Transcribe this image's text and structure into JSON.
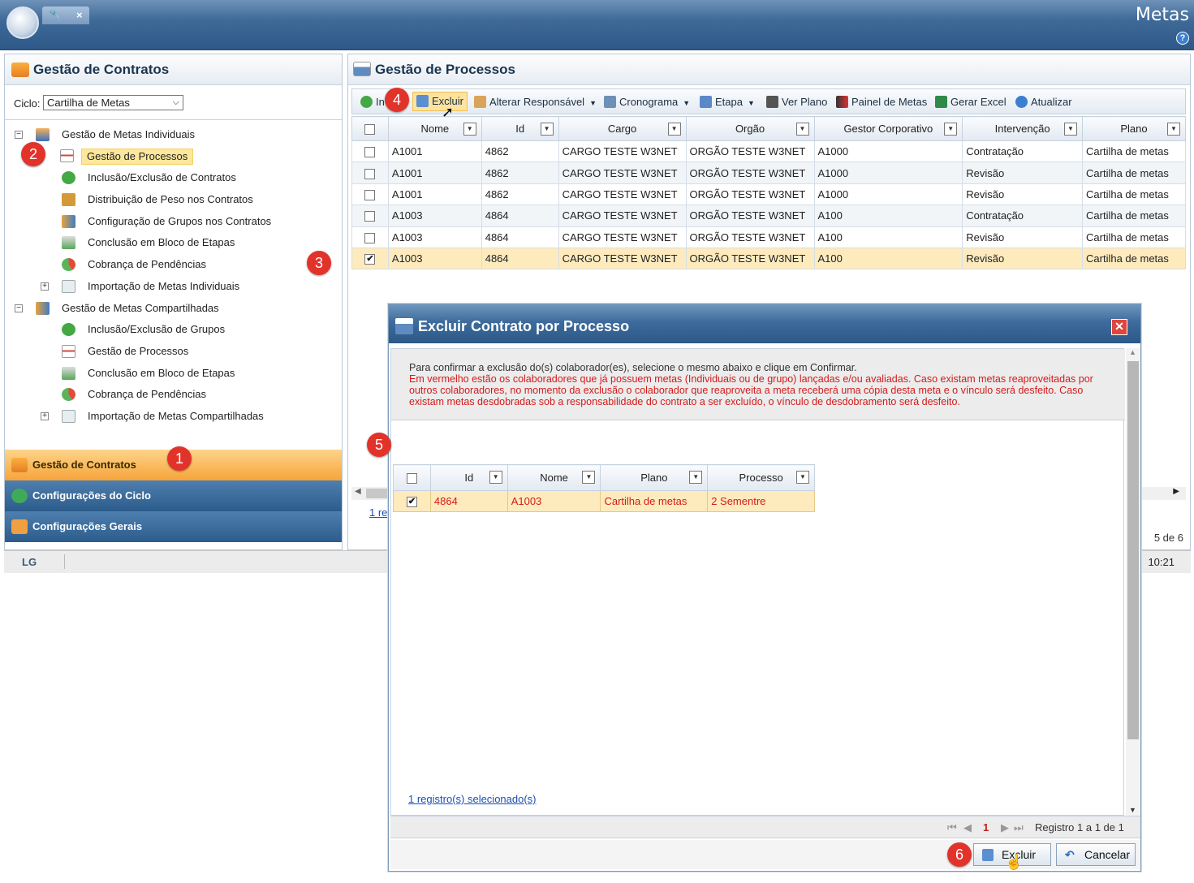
{
  "app": {
    "title": "Metas",
    "tab_icon": "wrench-icon",
    "tab_close": "×"
  },
  "left": {
    "title": "Gestão de Contratos",
    "ciclo_label": "Ciclo:",
    "ciclo_value": "Cartilha de Metas",
    "tree": [
      {
        "label": "Gestão de Metas Individuais",
        "expander": "⊟"
      },
      {
        "label": "Gestão de Processos"
      },
      {
        "label": "Inclusão/Exclusão de Contratos"
      },
      {
        "label": "Distribuição de Peso nos Contratos"
      },
      {
        "label": "Configuração de Grupos nos Contratos"
      },
      {
        "label": "Conclusão em Bloco de Etapas"
      },
      {
        "label": "Cobrança de Pendências"
      },
      {
        "label": "Importação de Metas Individuais",
        "expander": "⊞"
      },
      {
        "label": "Gestão de Metas Compartilhadas",
        "expander": "⊟"
      },
      {
        "label": "Inclusão/Exclusão de Grupos"
      },
      {
        "label": "Gestão de Processos"
      },
      {
        "label": "Conclusão em Bloco de Etapas"
      },
      {
        "label": "Cobrança de Pendências"
      },
      {
        "label": "Importação de Metas Compartilhadas",
        "expander": "⊞"
      }
    ],
    "accordion": [
      "Gestão de Contratos",
      "Configurações do Ciclo",
      "Configurações Gerais"
    ]
  },
  "right": {
    "title": "Gestão de Processos",
    "toolbar": {
      "incluir": "In",
      "excluir": "Excluir",
      "alterar": "Alterar Responsável",
      "cronograma": "Cronograma",
      "etapa": "Etapa",
      "ver_plano": "Ver Plano",
      "painel": "Painel de Metas",
      "gerar_excel": "Gerar Excel",
      "atualizar": "Atualizar"
    },
    "columns": [
      "Nome",
      "Id",
      "Cargo",
      "Orgão",
      "Gestor Corporativo",
      "Intervenção",
      "Plano"
    ],
    "rows": [
      {
        "checked": "",
        "nome": "A1001",
        "id": "4862",
        "cargo": "CARGO TESTE W3NET",
        "orgao": "ORGÃO TESTE W3NET",
        "gestor": "A1000",
        "intervencao": "Contratação",
        "plano": "Cartilha de metas"
      },
      {
        "checked": "",
        "nome": "A1001",
        "id": "4862",
        "cargo": "CARGO TESTE W3NET",
        "orgao": "ORGÃO TESTE W3NET",
        "gestor": "A1000",
        "intervencao": "Revisão",
        "plano": "Cartilha de metas"
      },
      {
        "checked": "",
        "nome": "A1001",
        "id": "4862",
        "cargo": "CARGO TESTE W3NET",
        "orgao": "ORGÃO TESTE W3NET",
        "gestor": "A1000",
        "intervencao": "Revisão",
        "plano": "Cartilha de metas"
      },
      {
        "checked": "",
        "nome": "A1003",
        "id": "4864",
        "cargo": "CARGO TESTE W3NET",
        "orgao": "ORGÃO TESTE W3NET",
        "gestor": "A100",
        "intervencao": "Contratação",
        "plano": "Cartilha de metas"
      },
      {
        "checked": "",
        "nome": "A1003",
        "id": "4864",
        "cargo": "CARGO TESTE W3NET",
        "orgao": "ORGÃO TESTE W3NET",
        "gestor": "A100",
        "intervencao": "Revisão",
        "plano": "Cartilha de metas"
      },
      {
        "checked": "✔",
        "nome": "A1003",
        "id": "4864",
        "cargo": "CARGO TESTE W3NET",
        "orgao": "ORGÃO TESTE W3NET",
        "gestor": "A100",
        "intervencao": "Revisão",
        "plano": "Cartilha de metas"
      }
    ],
    "pager_link": "1 re",
    "pager_right": "5 de 6"
  },
  "status": {
    "logo": "LG",
    "clock": "10:21"
  },
  "dialog": {
    "title": "Excluir Contrato por Processo",
    "close": "✕",
    "message1": "Para confirmar a exclusão do(s) colaborador(es), selecione o mesmo abaixo e clique em Confirmar.",
    "message2": "Em vermelho estão os colaboradores que já possuem metas (Individuais ou de grupo) lançadas e/ou avaliadas. Caso existam metas reaproveitadas por outros colaboradores, no momento da exclusão o colaborador que reaproveita a meta receberá uma cópia desta meta e o vínculo será desfeito. Caso existam metas desdobradas sob a responsabilidade do contrato a ser excluído, o vínculo de desdobramento será desfeito.",
    "columns": [
      "Id",
      "Nome",
      "Plano",
      "Processo"
    ],
    "row": {
      "checked": "✔",
      "id": "4864",
      "nome": "A1003",
      "plano": "Cartilha de metas",
      "processo": "2 Sementre"
    },
    "selected_link": "1 registro(s) selecionado(s)",
    "pager": {
      "first": "⏮",
      "prev": "◀",
      "page": "1",
      "next": "▶",
      "last": "⏭",
      "info": "Registro 1 a 1 de 1"
    },
    "btn_excluir": "Excluir",
    "btn_cancelar": "Cancelar"
  },
  "badges": [
    "1",
    "2",
    "3",
    "4",
    "5",
    "6"
  ],
  "colors": {
    "accent": "#2e5888",
    "highlight": "#fdebbd",
    "error_text": "#d51a1a",
    "badge": "#e2332b"
  }
}
